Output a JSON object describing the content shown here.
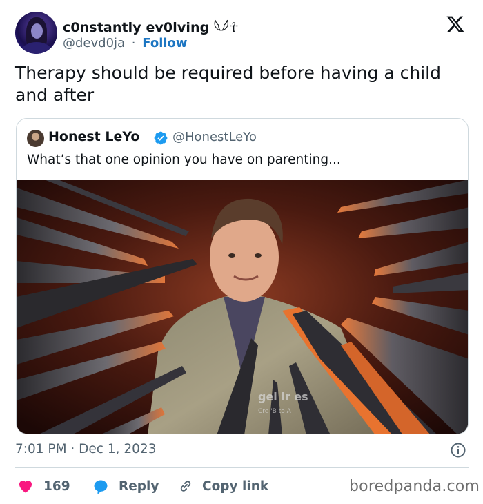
{
  "author": {
    "display_name": "c0nstantly ev0lving 𓆩𓆪☥",
    "handle": "@devd0ja",
    "separator": "·",
    "follow_label": "Follow"
  },
  "tweet": {
    "text": "Therapy should be required before having a child and after",
    "timestamp": "7:01 PM · Dec 1, 2023"
  },
  "quoted": {
    "name": "Honest LeYo",
    "handle": "@HonestLeYo",
    "text": "What’s that one opinion you have on parenting...",
    "image_watermark": "gettyimages Credit: ... to A..."
  },
  "actions": {
    "like_count": "169",
    "reply_label": "Reply",
    "copy_link_label": "Copy link"
  },
  "watermark": "boredpanda.com",
  "colors": {
    "like": "#f91880",
    "reply": "#1d9bf0",
    "link_blue": "#1d76c2",
    "verified": "#1d9bf0",
    "muted_text": "#536471"
  },
  "icons": [
    "x-logo-icon",
    "verified-badge-icon",
    "info-icon",
    "heart-icon",
    "reply-bubble-icon",
    "link-icon"
  ]
}
